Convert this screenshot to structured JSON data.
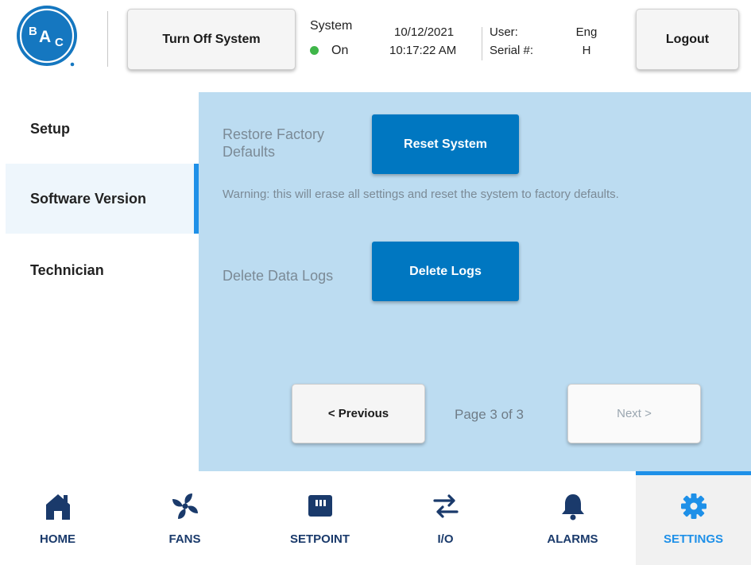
{
  "header": {
    "logo_text": "BAC",
    "turn_off_label": "Turn Off System",
    "system_label": "System",
    "system_state": "On",
    "date": "10/12/2021",
    "time": "10:17:22 AM",
    "user_label": "User:",
    "user_value": "Eng",
    "serial_label": "Serial #:",
    "serial_value": "H",
    "logout_label": "Logout",
    "status_color": "#3fb649"
  },
  "sidebar": {
    "items": [
      {
        "label": "Setup",
        "selected": false
      },
      {
        "label": "Software Version",
        "selected": true
      },
      {
        "label": "Technician",
        "selected": false
      }
    ]
  },
  "panel": {
    "restore_label": "Restore Factory Defaults",
    "reset_button": "Reset System",
    "warning": "Warning: this will erase all settings and reset the system to factory defaults.",
    "delete_label": "Delete Data Logs",
    "delete_button": "Delete Logs",
    "previous_button": "< Previous",
    "page_indicator": "Page 3 of 3",
    "next_button": "Next >"
  },
  "nav": {
    "items": [
      {
        "label": "HOME",
        "icon": "home-icon",
        "active": false
      },
      {
        "label": "FANS",
        "icon": "fan-icon",
        "active": false
      },
      {
        "label": "SETPOINT",
        "icon": "setpoint-icon",
        "active": false
      },
      {
        "label": "I/O",
        "icon": "io-arrows-icon",
        "active": false
      },
      {
        "label": "ALARMS",
        "icon": "bell-icon",
        "active": false
      },
      {
        "label": "SETTINGS",
        "icon": "gear-icon",
        "active": true
      }
    ]
  },
  "colors": {
    "brand_blue": "#0077c1",
    "accent_blue": "#1e90e8",
    "panel_bg": "#bcdcf1",
    "nav_text": "#1a3a6b"
  }
}
